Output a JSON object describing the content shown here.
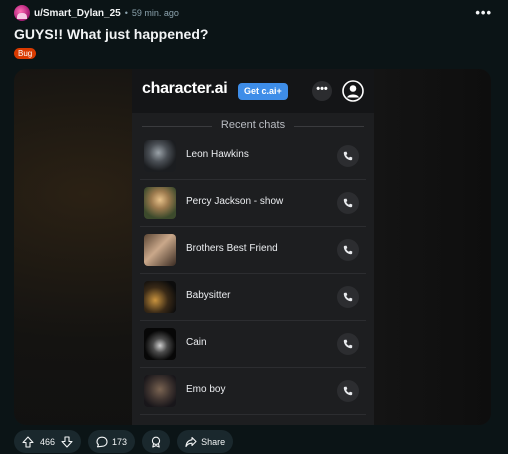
{
  "post": {
    "username": "u/Smart_Dylan_25",
    "separator": "•",
    "time": "59 min. ago",
    "more": "•••",
    "title": "GUYS!! What just happened?",
    "flair": "Bug"
  },
  "app": {
    "logo": "character.ai",
    "get_button": "Get c.ai+",
    "menu": "•••",
    "section_title": "Recent chats",
    "chats": [
      {
        "name": "Leon Hawkins"
      },
      {
        "name": "Percy Jackson - show"
      },
      {
        "name": "Brothers Best Friend"
      },
      {
        "name": "Babysitter"
      },
      {
        "name": "Cain"
      },
      {
        "name": "Emo boy"
      }
    ]
  },
  "footer": {
    "votes": "466",
    "comments": "173",
    "share": "Share"
  },
  "icons": {
    "upvote": "arrow-up-icon",
    "downvote": "arrow-down-icon",
    "comment": "comment-bubble-icon",
    "award": "award-icon",
    "share": "share-arrow-icon",
    "call": "phone-icon",
    "profile": "user-icon"
  },
  "colors": {
    "background": "#0b1416",
    "flair": "#d93a00",
    "accent_button": "#3e8de8",
    "pill": "#1a282d"
  }
}
